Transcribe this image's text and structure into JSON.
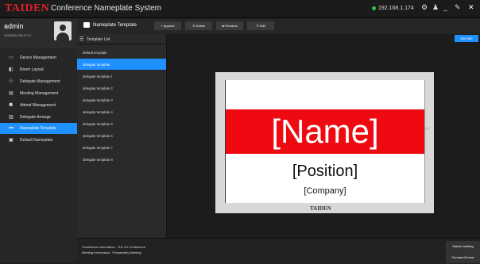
{
  "app": {
    "logo": "TAIDEN",
    "title": "Conference Nameplate System",
    "ip": "192.168.1.174",
    "status_color": "#36c24a"
  },
  "user": {
    "name": "admin",
    "datetime": "2025/8/19 08:47:21"
  },
  "nav": [
    {
      "icon": "monitor-icon",
      "label": "Device Management",
      "active": false
    },
    {
      "icon": "layout-icon",
      "label": "Room Layout",
      "active": false
    },
    {
      "icon": "users-icon",
      "label": "Delegate Management",
      "active": false
    },
    {
      "icon": "meeting-icon",
      "label": "Meeting Management",
      "active": false
    },
    {
      "icon": "attend-icon",
      "label": "Attend Management",
      "active": false
    },
    {
      "icon": "arrange-icon",
      "label": "Delegate Arrange",
      "active": false
    },
    {
      "icon": "nameplate-icon",
      "label": "Nameplate Template",
      "active": true
    },
    {
      "icon": "default-icon",
      "label": "Default Nameplate",
      "active": false
    }
  ],
  "toolbar": {
    "title": "Nameplate Template",
    "append": "Append",
    "delete": "Delete",
    "rename": "Rename",
    "edit": "Edit"
  },
  "template_list": {
    "header": "Template List",
    "items": [
      "default template",
      "delegate template",
      "delegate template 1",
      "delegate template 2",
      "delegate template 3",
      "delegate template 4",
      "delegate template 5",
      "delegate template 6",
      "delegate template 7",
      "delegate template 8"
    ],
    "selected_index": 1
  },
  "preview": {
    "resolution": "800*480",
    "name": "[Name]",
    "position": "[Position]",
    "company": "[Company]",
    "brand": "TAIDEN",
    "band_color": "#ef0a12",
    "side_mark": "(+)"
  },
  "footer": {
    "conf_label": "Conference information:",
    "conf_value": "The XX Conference",
    "meet_label": "Meeting information:",
    "meet_value": "Preparatory Meeting",
    "select_meeting": "Select meeting",
    "connect_device": "Connect Device"
  }
}
